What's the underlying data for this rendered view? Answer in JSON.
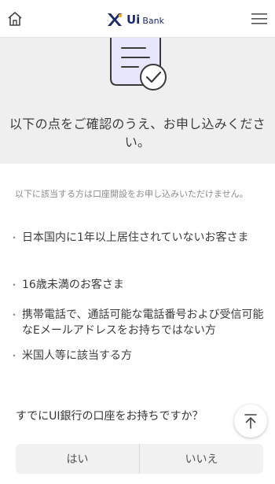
{
  "header": {
    "logo_ui": "Ui",
    "logo_bank": "Bank"
  },
  "hero": {
    "title": "以下の点をご確認のうえ、お申し込みください。"
  },
  "content": {
    "intro": "以下に該当する方は口座開設をお申し込みいただけません。",
    "items": [
      "日本国内に1年以上居住されていないお客さま",
      "16歳未満のお客さま",
      "携帯電話で、通話可能な電話番号および受信可能なEメールアドレスをお持ちではない方",
      "米国人等に該当する方"
    ]
  },
  "question": {
    "text": "すでにUI銀行の口座をお持ちですか？",
    "options": [
      "はい",
      "いいえ"
    ]
  }
}
